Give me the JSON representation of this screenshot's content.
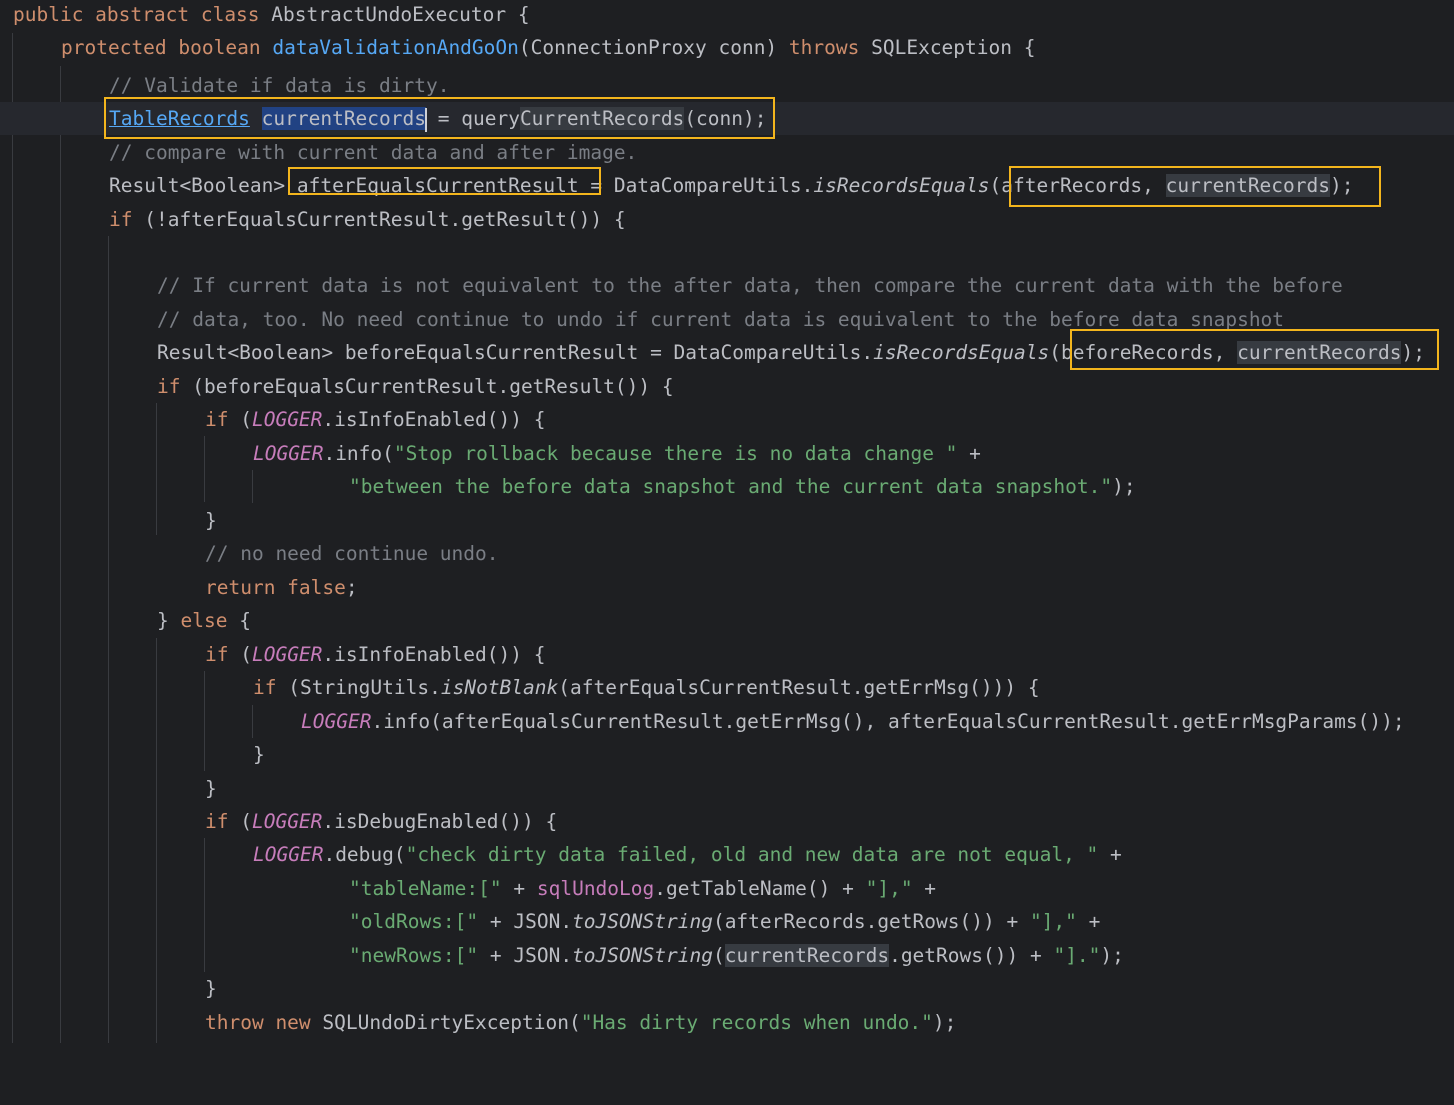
{
  "code": {
    "l1": {
      "kw": "public abstract class",
      "rest": " AbstractUndoExecutor {"
    },
    "l2": {
      "kw": "protected boolean",
      "method": "dataValidationAndGoOn",
      "params": "(ConnectionProxy conn) ",
      "throws": "throws",
      "rest": " SQLException {"
    },
    "l3": {
      "comment": "// Validate if data is dirty."
    },
    "l4": {
      "type": "TableRecords",
      "var": "currentRecords",
      "eq": " = query",
      "call": "CurrentRecords",
      "rest": "(conn);"
    },
    "l5": {
      "comment": "// compare with current data and after image."
    },
    "l6": {
      "a": "Result<Boolean> ",
      "var": "afterEqualsCurrentResult",
      "b": " = DataCompareUtils.",
      "method": "isRecordsEquals",
      "c": "(afterRecords, ",
      "hl": "currentRecords",
      "d": ");"
    },
    "l7": {
      "kw": "if",
      "rest": " (!afterEqualsCurrentResult.getResult()) {"
    },
    "l8": {
      "comment": "// If current data is not equivalent to the after data, then compare the current data with the before"
    },
    "l9": {
      "comment": "// data, too. No need continue to undo if current data is equivalent to the before data snapshot"
    },
    "l10": {
      "a": "Result<Boolean> beforeEqualsCurrentResult = DataCompareUtils.",
      "method": "isRecordsEquals",
      "c": "(beforeRecords, ",
      "hl": "currentRecords",
      "d": ");"
    },
    "l11": {
      "kw": "if",
      "rest": " (beforeEqualsCurrentResult.getResult()) {"
    },
    "l12": {
      "kw": "if",
      "a": " (",
      "logger": "LOGGER",
      "rest": ".isInfoEnabled()) {"
    },
    "l13": {
      "logger": "LOGGER",
      "a": ".info(",
      "str": "\"Stop rollback because there is no data change \"",
      "rest": " +"
    },
    "l14": {
      "str": "\"between the before data snapshot and the current data snapshot.\"",
      "rest": ");"
    },
    "l15": {
      "text": "}"
    },
    "l16": {
      "comment": "// no need continue undo."
    },
    "l17": {
      "kw": "return false",
      "rest": ";"
    },
    "l18": {
      "a": "} ",
      "kw": "else",
      "rest": " {"
    },
    "l19": {
      "kw": "if",
      "a": " (",
      "logger": "LOGGER",
      "rest": ".isInfoEnabled()) {"
    },
    "l20": {
      "kw": "if",
      "a": " (StringUtils.",
      "method": "isNotBlank",
      "rest": "(afterEqualsCurrentResult.getErrMsg())) {"
    },
    "l21": {
      "logger": "LOGGER",
      "rest": ".info(afterEqualsCurrentResult.getErrMsg(), afterEqualsCurrentResult.getErrMsgParams());"
    },
    "l22": {
      "text": "}"
    },
    "l23": {
      "text": "}"
    },
    "l24": {
      "kw": "if",
      "a": " (",
      "logger": "LOGGER",
      "rest": ".isDebugEnabled()) {"
    },
    "l25": {
      "logger": "LOGGER",
      "a": ".debug(",
      "str": "\"check dirty data failed, old and new data are not equal, \"",
      "rest": " +"
    },
    "l26": {
      "str1": "\"tableName:[\"",
      "a": " + ",
      "field": "sqlUndoLog",
      "b": ".getTableName() + ",
      "str2": "\"],\"",
      "rest": " +"
    },
    "l27": {
      "str1": "\"oldRows:[\"",
      "a": " + JSON.",
      "method": "toJSONString",
      "b": "(afterRecords.getRows()) + ",
      "str2": "\"],\"",
      "rest": " +"
    },
    "l28": {
      "str1": "\"newRows:[\"",
      "a": " + JSON.",
      "method": "toJSONString",
      "b": "(",
      "hl": "currentRecords",
      "c": ".getRows()) + ",
      "str2": "\"].\"",
      "rest": ");"
    },
    "l29": {
      "text": "}"
    },
    "l30": {
      "kw": "throw new",
      "a": " SQLUndoDirtyException(",
      "str": "\"Has dirty records when undo.\"",
      "rest": ");"
    }
  },
  "colors": {
    "background": "#1e1f22",
    "keyword": "#cf8e6d",
    "method": "#56a8f5",
    "comment": "#7a7e85",
    "string": "#6aab73",
    "constant": "#c77dbb",
    "highlight_box": "#f3b51d"
  }
}
